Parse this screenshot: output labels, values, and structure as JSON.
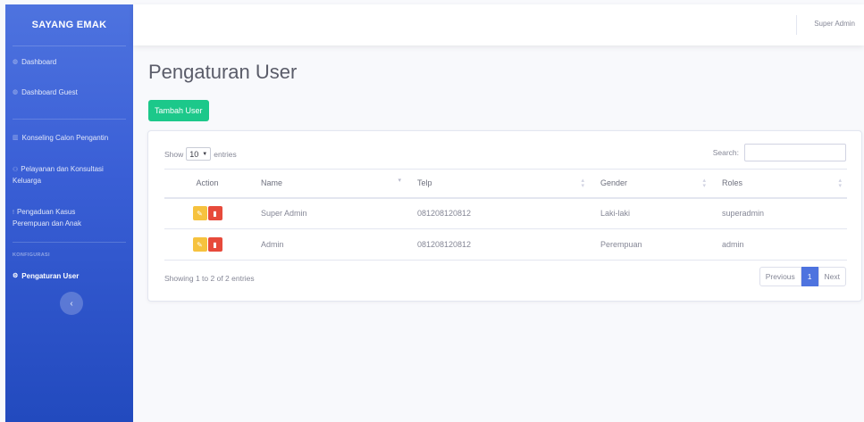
{
  "brand": "SAYANG EMAK",
  "sidebar": {
    "items": [
      {
        "label": "Dashboard",
        "icon": "tachometer-icon"
      },
      {
        "label": "Dashboard Guest",
        "icon": "tachometer-icon"
      },
      {
        "label": "Konseling Calon Pengantin",
        "icon": "book-icon"
      },
      {
        "label": "Pelayanan dan Konsultasi Keluarga",
        "icon": "users-icon"
      },
      {
        "label": "Pengaduan Kasus Perempuan dan Anak",
        "icon": "exclamation-icon"
      }
    ],
    "heading": "KONFIGURASI",
    "active_item": {
      "label": "Pengaturan User",
      "icon": "cogs-icon"
    },
    "toggle_icon": "chevron-left-icon"
  },
  "topbar": {
    "user": "Super Admin"
  },
  "page": {
    "title": "Pengaturan User",
    "add_button": "Tambah User"
  },
  "table": {
    "show_label": "Show",
    "page_length": "10",
    "entries_label": "entries",
    "search_label": "Search:",
    "search_value": "",
    "headers": [
      "Action",
      "Name",
      "Telp",
      "Gender",
      "Roles"
    ],
    "rows": [
      {
        "name": "Super Admin",
        "telp": "081208120812",
        "gender": "Laki-laki",
        "role": "superadmin"
      },
      {
        "name": "Admin",
        "telp": "081208120812",
        "gender": "Perempuan",
        "role": "admin"
      }
    ],
    "info": "Showing 1 to 2 of 2 entries",
    "pagination": {
      "previous": "Previous",
      "current": "1",
      "next": "Next"
    }
  },
  "colors": {
    "sidebar": "#4e73df",
    "success": "#1cc88a",
    "warning": "#f6c23e",
    "danger": "#e74a3b",
    "primary": "#4e73df"
  }
}
